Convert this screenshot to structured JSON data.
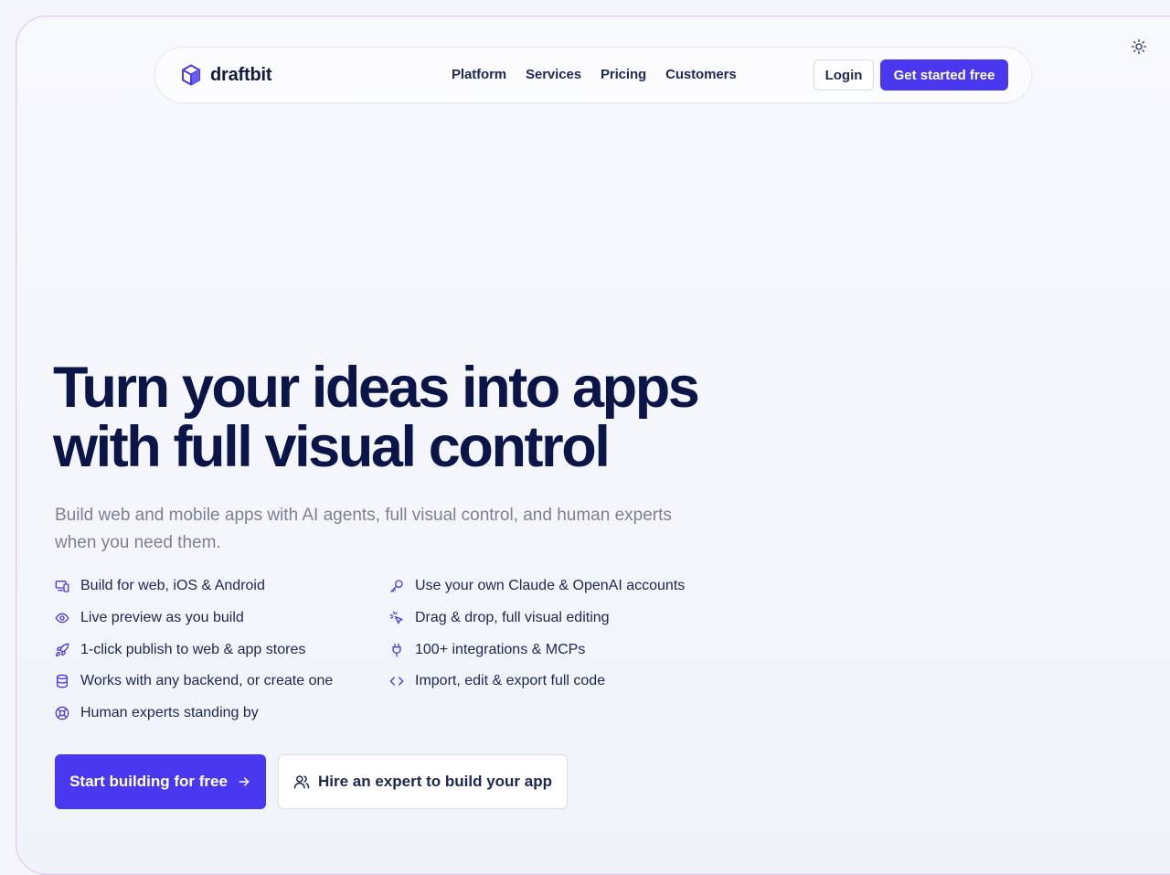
{
  "brand": {
    "name": "draftbit",
    "accent": "#4a38f0",
    "heading_color": "#0c1547"
  },
  "header": {
    "nav_links": [
      "Platform",
      "Services",
      "Pricing",
      "Customers"
    ],
    "login_label": "Login",
    "cta_label": "Get started free",
    "theme_toggle_icon": "sun-icon"
  },
  "hero": {
    "headline_line1": "Turn your ideas into apps",
    "headline_line2": "with full visual control",
    "subtext": "Build web and mobile apps with AI agents, full visual control, and human experts when you need them.",
    "features": [
      {
        "icon": "devices-icon",
        "label": "Build for web, iOS & Android"
      },
      {
        "icon": "key-icon",
        "label": "Use your own Claude & OpenAI accounts"
      },
      {
        "icon": "eye-icon",
        "label": "Live preview as you build"
      },
      {
        "icon": "cursor-click-icon",
        "label": "Drag & drop, full visual editing"
      },
      {
        "icon": "rocket-icon",
        "label": "1-click publish to web & app stores"
      },
      {
        "icon": "plug-icon",
        "label": "100+ integrations & MCPs"
      },
      {
        "icon": "database-icon",
        "label": "Works with any backend, or create one"
      },
      {
        "icon": "code-icon",
        "label": "Import, edit & export full code"
      },
      {
        "icon": "lifebuoy-icon",
        "label": "Human experts standing by"
      }
    ],
    "primary_button": "Start building for free",
    "secondary_button": "Hire an expert to build your app"
  }
}
